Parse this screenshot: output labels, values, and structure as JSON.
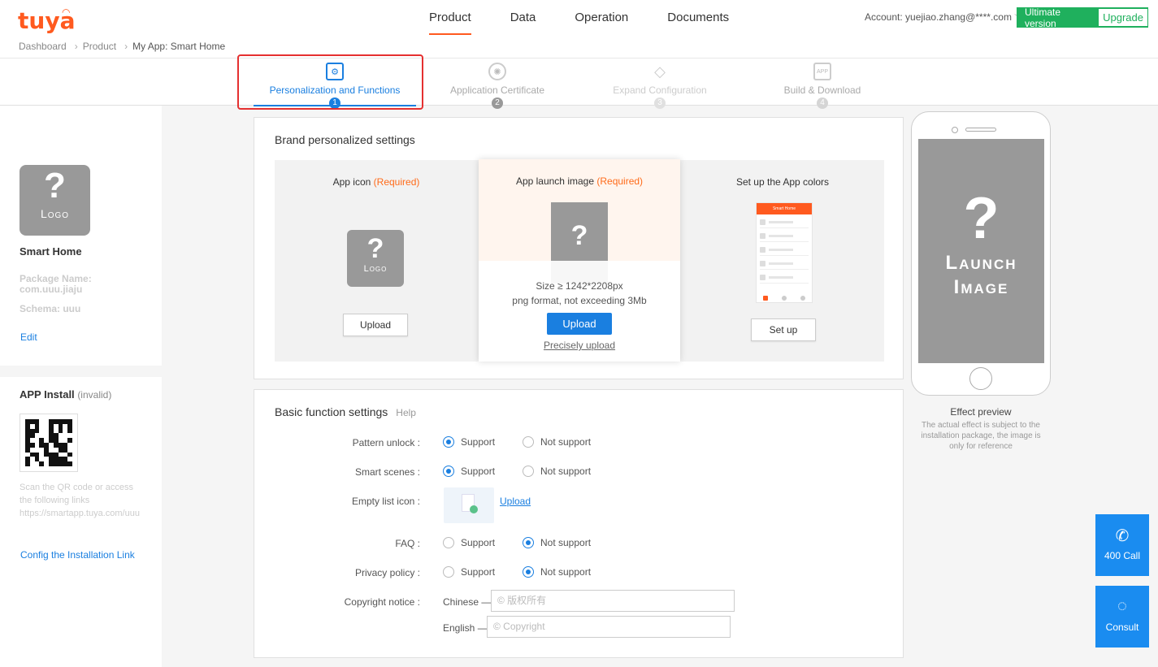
{
  "header": {
    "logo": "tuya",
    "nav": [
      "Product",
      "Data",
      "Operation",
      "Documents"
    ],
    "active_nav": "Product",
    "account": "Account: yuejiao.zhang@****.com",
    "version_label": "Ultimate version",
    "upgrade_label": "Upgrade"
  },
  "breadcrumb": [
    "Dashboard",
    "Product",
    "My App: Smart Home"
  ],
  "steps": [
    {
      "label": "Personalization and Functions",
      "num": "1",
      "icon": "gear-icon"
    },
    {
      "label": "Application Certificate",
      "num": "2",
      "icon": "certificate-icon"
    },
    {
      "label": "Expand Configuration",
      "num": "3",
      "icon": "diamond-icon"
    },
    {
      "label": "Build & Download",
      "num": "4",
      "icon": "app-icon"
    }
  ],
  "left": {
    "logo_text": "Logo",
    "app_name": "Smart Home",
    "package": "Package Name: com.uuu.jiaju",
    "schema": "Schema: uuu",
    "edit": "Edit",
    "install_title": "APP Install",
    "install_status": "(invalid)",
    "scan_text": "Scan the QR code or access the following links",
    "link": "https://smartapp.tuya.com/uuu",
    "config_link": "Config the Installation Link"
  },
  "brand": {
    "title": "Brand personalized settings",
    "required": "(Required)",
    "app_icon_title": "App icon",
    "app_icon_logo": "Logo",
    "app_icon_upload": "Upload",
    "launch_title": "App launch image",
    "launch_size": "Size ≥ 1242*2208px",
    "launch_format": "png format, not exceeding 3Mb",
    "launch_upload": "Upload",
    "launch_precise": "Precisely upload",
    "colors_title": "Set up the App colors",
    "colors_header": "Smart Home",
    "colors_btn": "Set up"
  },
  "basic": {
    "title": "Basic function settings",
    "help": "Help",
    "support": "Support",
    "not_support": "Not support",
    "rows": [
      {
        "label": "Pattern unlock :",
        "value": "Support"
      },
      {
        "label": "Smart scenes :",
        "value": "Support"
      },
      {
        "label": "Empty list icon :"
      },
      {
        "label": "FAQ :",
        "value": "Not support"
      },
      {
        "label": "Privacy policy :",
        "value": "Not support"
      },
      {
        "label": "Copyright notice :"
      }
    ],
    "upload_link": "Upload",
    "chinese_label": "Chinese —",
    "chinese_placeholder": "© 版权所有",
    "english_label": "English —",
    "english_placeholder": "© Copyright"
  },
  "preview": {
    "launch_line1": "Launch",
    "launch_line2": "Image",
    "title": "Effect preview",
    "desc": "The actual effect is subject to the installation package, the image is only for reference"
  },
  "float": {
    "call": "400 Call",
    "consult": "Consult"
  },
  "colors": {
    "accent": "#1a7fe0",
    "brand": "#ff5a1f",
    "green": "#1fb05d"
  }
}
